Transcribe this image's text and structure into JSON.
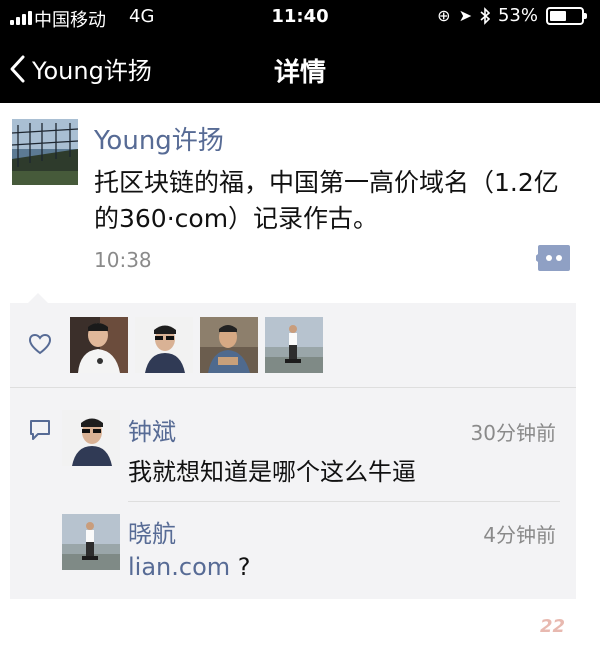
{
  "status_bar": {
    "carrier": "中国移动",
    "network": "4G",
    "time": "11:40",
    "battery": "53%",
    "battery_level": 0.53
  },
  "nav": {
    "back_label": "Young许扬",
    "title": "详情"
  },
  "post": {
    "author": "Young许扬",
    "content": "托区块链的福，中国第一高价域名（1.2亿的360·com）记录作古。",
    "time": "10:38"
  },
  "likes": {
    "count_shown": 4
  },
  "comments": [
    {
      "name": "钟斌",
      "time": "30分钟前",
      "text": "我就想知道是哪个这么牛逼"
    },
    {
      "name": "晓航",
      "time": "4分钟前",
      "link": "lian.com",
      "text_after": " ?"
    }
  ],
  "colors": {
    "link": "#576b95",
    "header_bg": "#000000",
    "panel_bg": "#f3f3f5"
  },
  "icons": [
    "back-chevron-icon",
    "heart-icon",
    "comment-icon",
    "more-dots-icon",
    "location-icon",
    "bluetooth-icon",
    "rotation-lock-icon"
  ],
  "watermark": "22"
}
